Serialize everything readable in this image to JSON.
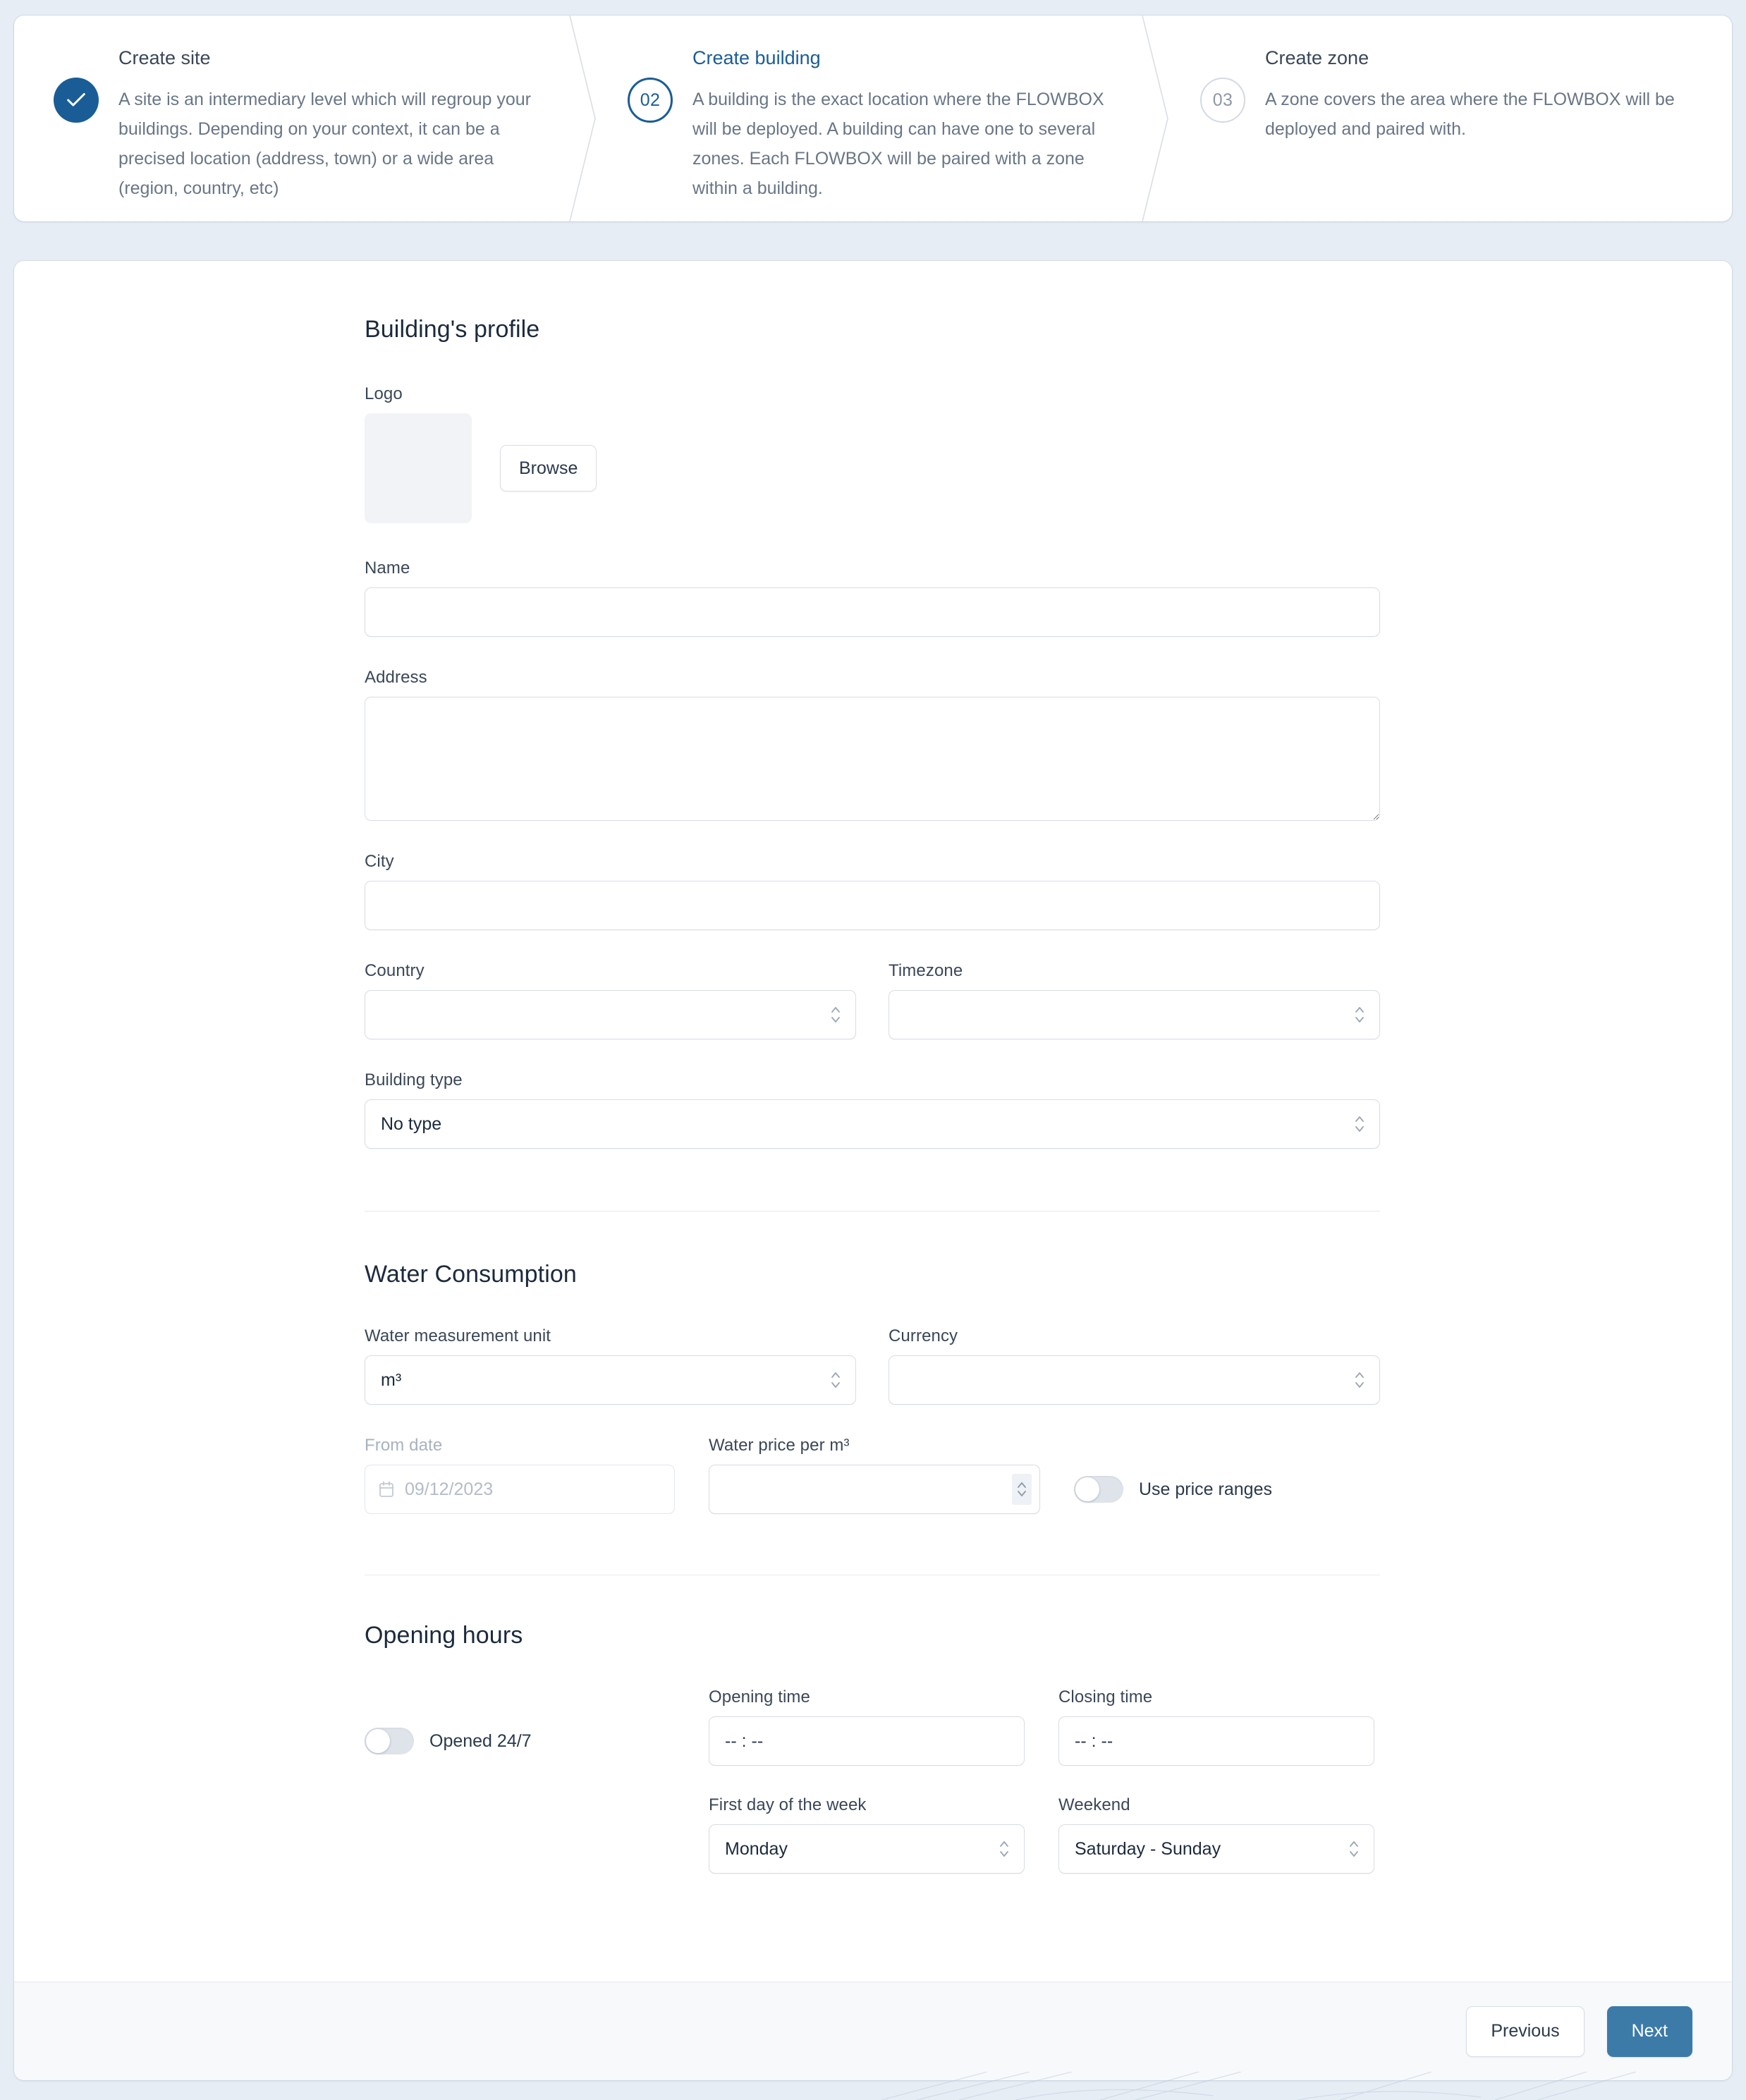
{
  "stepper": {
    "steps": [
      {
        "badge": "check-icon",
        "state": "done",
        "title": "Create site",
        "description": "A site is an intermediary level which will regroup your buildings. Depending on your context, it can be a precised location (address, town) or a wide area (region, country, etc)"
      },
      {
        "badge": "02",
        "state": "current",
        "title": "Create building",
        "description": "A building is the exact location where the FLOWBOX will be deployed. A building can have one to several zones. Each FLOWBOX will be paired with a zone within a building."
      },
      {
        "badge": "03",
        "state": "todo",
        "title": "Create zone",
        "description": "A zone covers the area where the FLOWBOX will be deployed and paired with."
      }
    ]
  },
  "profile": {
    "section_title": "Building's profile",
    "logo_label": "Logo",
    "browse_label": "Browse",
    "name_label": "Name",
    "name_value": "",
    "name_placeholder": "",
    "address_label": "Address",
    "address_value": "",
    "address_placeholder": "",
    "city_label": "City",
    "city_value": "",
    "city_placeholder": "",
    "country_label": "Country",
    "country_value": "",
    "timezone_label": "Timezone",
    "timezone_value": "",
    "building_type_label": "Building type",
    "building_type_value": "No type"
  },
  "water": {
    "section_title": "Water Consumption",
    "unit_label": "Water measurement unit",
    "unit_value": "m³",
    "currency_label": "Currency",
    "currency_value": "",
    "from_date_label": "From date",
    "from_date_value": "09/12/2023",
    "price_label": "Water price per m³",
    "price_value": "",
    "price_placeholder": "",
    "price_ranges_label": "Use price ranges",
    "price_ranges_on": false
  },
  "hours": {
    "section_title": "Opening hours",
    "opened_247_label": "Opened 24/7",
    "opened_247_on": false,
    "opening_time_label": "Opening time",
    "opening_time_value": "-- : --",
    "closing_time_label": "Closing time",
    "closing_time_value": "-- : --",
    "first_day_label": "First day of the week",
    "first_day_value": "Monday",
    "weekend_label": "Weekend",
    "weekend_value": "Saturday - Sunday"
  },
  "footer": {
    "previous_label": "Previous",
    "next_label": "Next"
  },
  "colors": {
    "page_background": "#e7edf4",
    "accent_blue": "#1a5d96",
    "primary_button": "#3c7aa8",
    "card_background": "#ffffff",
    "border": "#d7dde5",
    "text_primary": "#1c2a3d",
    "text_secondary": "#6a7686",
    "muted": "#a9b2bf"
  }
}
